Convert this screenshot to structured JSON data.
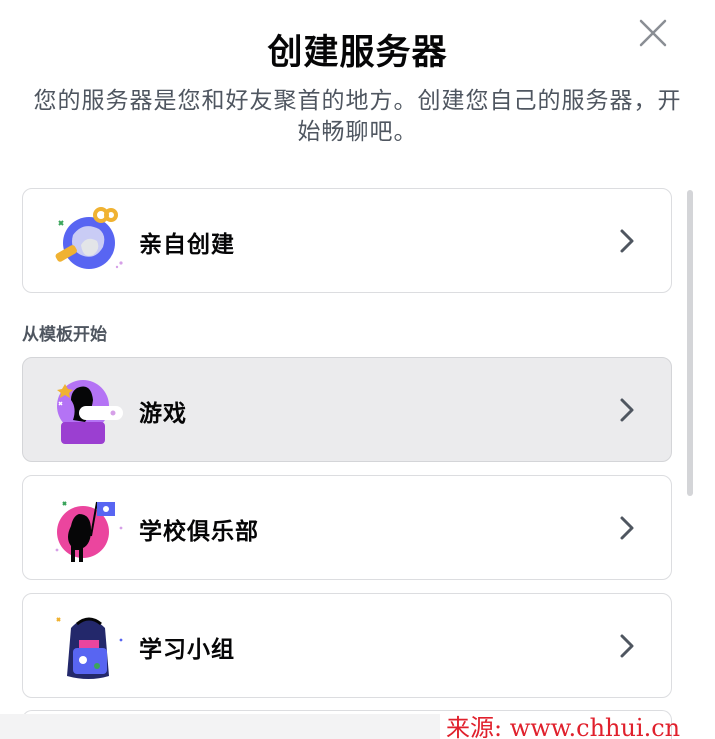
{
  "dialog": {
    "title": "创建服务器",
    "subtitle": "您的服务器是您和好友聚首的地方。创建您自己的服务器，开始畅聊吧。",
    "close_icon": "close-icon"
  },
  "create_own": {
    "label": "亲自创建",
    "icon": "globe-key-illustration"
  },
  "templates_section": {
    "heading": "从模板开始",
    "items": [
      {
        "label": "游戏",
        "icon": "gaming-illustration"
      },
      {
        "label": "学校俱乐部",
        "icon": "school-club-illustration"
      },
      {
        "label": "学习小组",
        "icon": "backpack-illustration"
      }
    ]
  },
  "watermark": "来源: www.chhui.cn",
  "colors": {
    "text_primary": "#060607",
    "text_secondary": "#4f5660",
    "card_border": "#dcdde0",
    "card_hover_bg": "#ebebed",
    "watermark": "#e0202c"
  }
}
